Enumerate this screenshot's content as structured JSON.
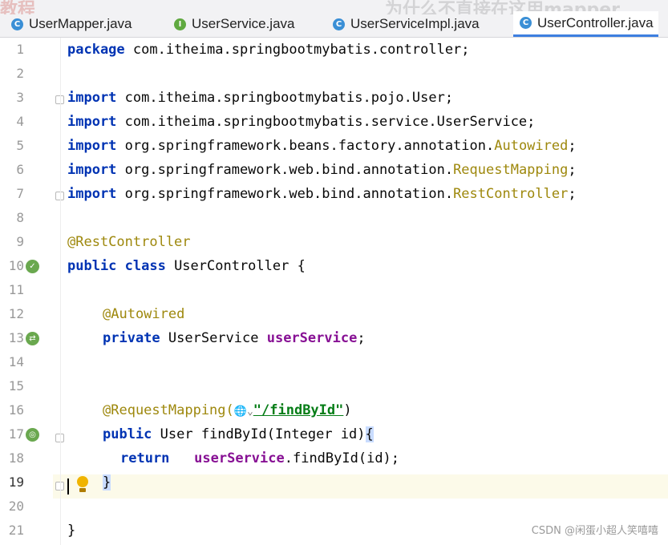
{
  "tabs": [
    {
      "label": "UserMapper.java",
      "icon": "class-file-icon",
      "active": false
    },
    {
      "label": "UserService.java",
      "icon": "interface-file-icon",
      "active": false
    },
    {
      "label": "UserServiceImpl.java",
      "icon": "class-file-icon",
      "active": false
    },
    {
      "label": "UserController.java",
      "icon": "class-file-icon",
      "active": true
    }
  ],
  "overlay_text": {
    "left": "教程",
    "right": "为什么不直接在这用mapper"
  },
  "editor": {
    "current_line": 19,
    "line_numbers": [
      "1",
      "2",
      "3",
      "4",
      "5",
      "6",
      "7",
      "8",
      "9",
      "10",
      "11",
      "12",
      "13",
      "14",
      "15",
      "16",
      "17",
      "18",
      "19",
      "20",
      "21"
    ],
    "code": {
      "l1_kw": "package",
      "l1_rest": " com.itheima.springbootmybatis.controller;",
      "l3_kw": "import",
      "l3_rest": " com.itheima.springbootmybatis.pojo.User;",
      "l4_kw": "import",
      "l4_rest": " com.itheima.springbootmybatis.service.UserService;",
      "l5_kw": "import",
      "l5_pre": " org.springframework.beans.factory.annotation.",
      "l5_cls": "Autowired",
      "l5_end": ";",
      "l6_kw": "import",
      "l6_pre": " org.springframework.web.bind.annotation.",
      "l6_cls": "RequestMapping",
      "l6_end": ";",
      "l7_kw": "import",
      "l7_pre": " org.springframework.web.bind.annotation.",
      "l7_cls": "RestController",
      "l7_end": ";",
      "l9_ann": "@RestController",
      "l10_kw": "public class",
      "l10_rest": " UserController {",
      "l12_ann": "@Autowired",
      "l13_kw": "private",
      "l13_type": " UserService ",
      "l13_fld": "userService",
      "l13_end": ";",
      "l16_ann": "@RequestMapping(",
      "l16_globe": "🌐⌄",
      "l16_str": "\"/findById\"",
      "l16_end": ")",
      "l17_kw": "public",
      "l17_rest": " User findById(Integer id)",
      "l17_brace": "{",
      "l18_kw": "return",
      "l18_fld": "userService",
      "l18_rest": ".findById(id);",
      "l19_brace": "}",
      "l21_brace": "}"
    }
  },
  "watermark": "CSDN @闲蛋小超人笑嘻嘻",
  "colors": {
    "keyword": "#0033b3",
    "annotation": "#9e880d",
    "field": "#871094",
    "string": "#067d17",
    "current_line_bg": "#fcfae9",
    "active_tab_underline": "#3d7fe0"
  }
}
